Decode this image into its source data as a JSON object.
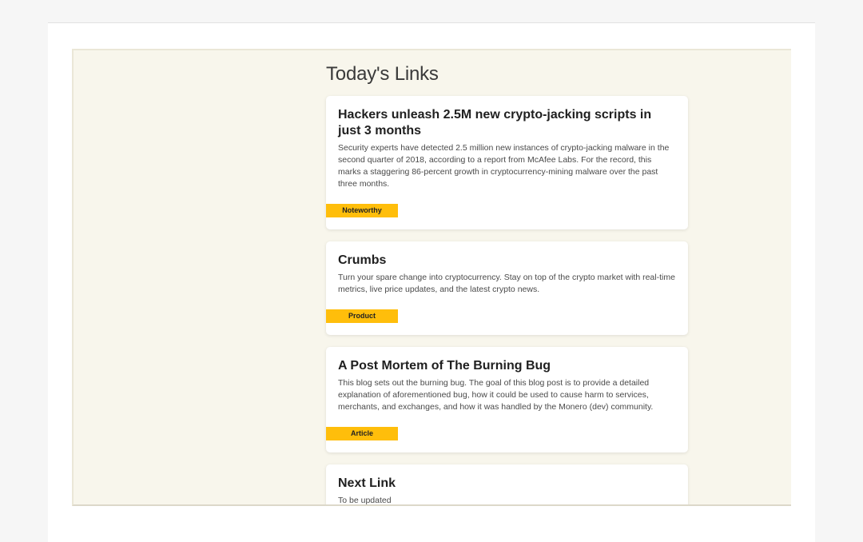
{
  "section": {
    "title": "Today's Links"
  },
  "links": [
    {
      "title": "Hackers unleash 2.5M new crypto-jacking scripts in just 3 months",
      "description": "Security experts have detected 2.5 million new instances of crypto-jacking malware in the second quarter of 2018, according to a report from McAfee Labs. For the record, this marks a staggering 86-percent growth in cryptocurrency-mining malware over the past three months.",
      "tag": "Noteworthy"
    },
    {
      "title": "Crumbs",
      "description": "Turn your spare change into cryptocurrency. Stay on top of the crypto market with real-time metrics, live price updates, and the latest crypto news.",
      "tag": "Product"
    },
    {
      "title": "A Post Mortem of The Burning Bug",
      "description": "This blog sets out the burning bug. The goal of this blog post is to provide a detailed explanation of aforementioned bug, how it could be used to cause harm to services, merchants, and exchanges, and how it was handled by the Monero (dev) community.",
      "tag": "Article"
    },
    {
      "title": "Next Link",
      "description": "To be updated"
    }
  ],
  "colors": {
    "tag_background": "#ffbe0b",
    "content_background": "#f8f6ec"
  }
}
